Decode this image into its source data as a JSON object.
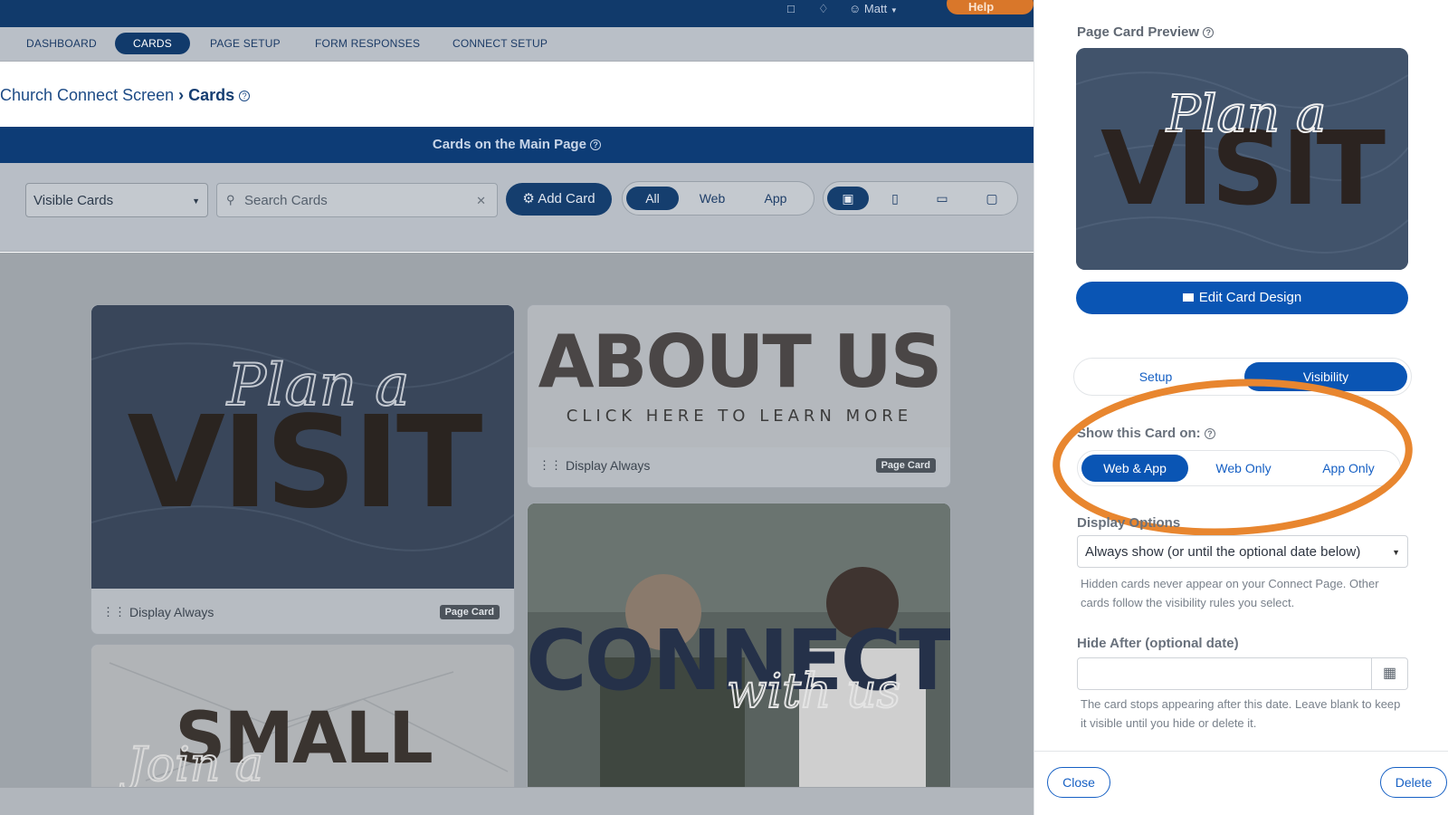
{
  "topbar": {
    "user_name": "Matt",
    "help_label": "Help",
    "icons": [
      "document-icon",
      "bell-icon",
      "user-circle-icon"
    ]
  },
  "nav": {
    "items": [
      {
        "label": "DASHBOARD",
        "active": false
      },
      {
        "label": "CARDS",
        "active": true
      },
      {
        "label": "PAGE SETUP",
        "active": false
      },
      {
        "label": "FORM RESPONSES",
        "active": false
      },
      {
        "label": "CONNECT SETUP",
        "active": false
      }
    ]
  },
  "breadcrumb": {
    "parent": "Church Connect Screen",
    "current": "Cards"
  },
  "section_header": "Cards on the Main Page",
  "filters": {
    "visibility_select": "Visible Cards",
    "search_placeholder": "Search Cards",
    "add_card_label": "Add Card",
    "platform_options": [
      "All",
      "Web",
      "App"
    ],
    "platform_selected": "All",
    "view_icons": [
      "grid-icon",
      "phone-icon",
      "tablet-icon",
      "desktop-icon"
    ]
  },
  "cards": [
    {
      "title_script": "Plan a",
      "title_main": "VISIT",
      "display": "Display Always",
      "badge": "Page Card"
    },
    {
      "title_main": "ABOUT US",
      "subtitle": "CLICK HERE TO LEARN MORE",
      "display": "Display Always",
      "badge": "Page Card"
    },
    {
      "title_main": "CONNECT",
      "title_script": "with us"
    },
    {
      "title_script": "Join a",
      "title_main": "SMALL"
    }
  ],
  "panel": {
    "preview_title": "Page Card Preview",
    "preview_script": "Plan a",
    "preview_main": "VISIT",
    "edit_button": "Edit Card Design",
    "tabs": [
      {
        "label": "Setup",
        "active": false
      },
      {
        "label": "Visibility",
        "active": true
      }
    ],
    "show_on_label": "Show this Card on:",
    "show_on_options": [
      {
        "label": "Web & App",
        "active": true
      },
      {
        "label": "Web Only",
        "active": false
      },
      {
        "label": "App Only",
        "active": false
      }
    ],
    "display_options_label": "Display Options",
    "display_options_value": "Always show (or until the optional date below)",
    "display_help": "Hidden cards never appear on your Connect Page. Other cards follow the visibility rules you select.",
    "hide_after_label": "Hide After (optional date)",
    "hide_after_value": "",
    "hide_after_help": "The card stops appearing after this date. Leave blank to keep it visible until you hide or delete it.",
    "close_label": "Close",
    "delete_label": "Delete"
  },
  "colors": {
    "primary_blue": "#0a55b4",
    "nav_dark": "#113a6b",
    "highlight_orange": "#e8862f",
    "help_orange": "#d9772a"
  }
}
